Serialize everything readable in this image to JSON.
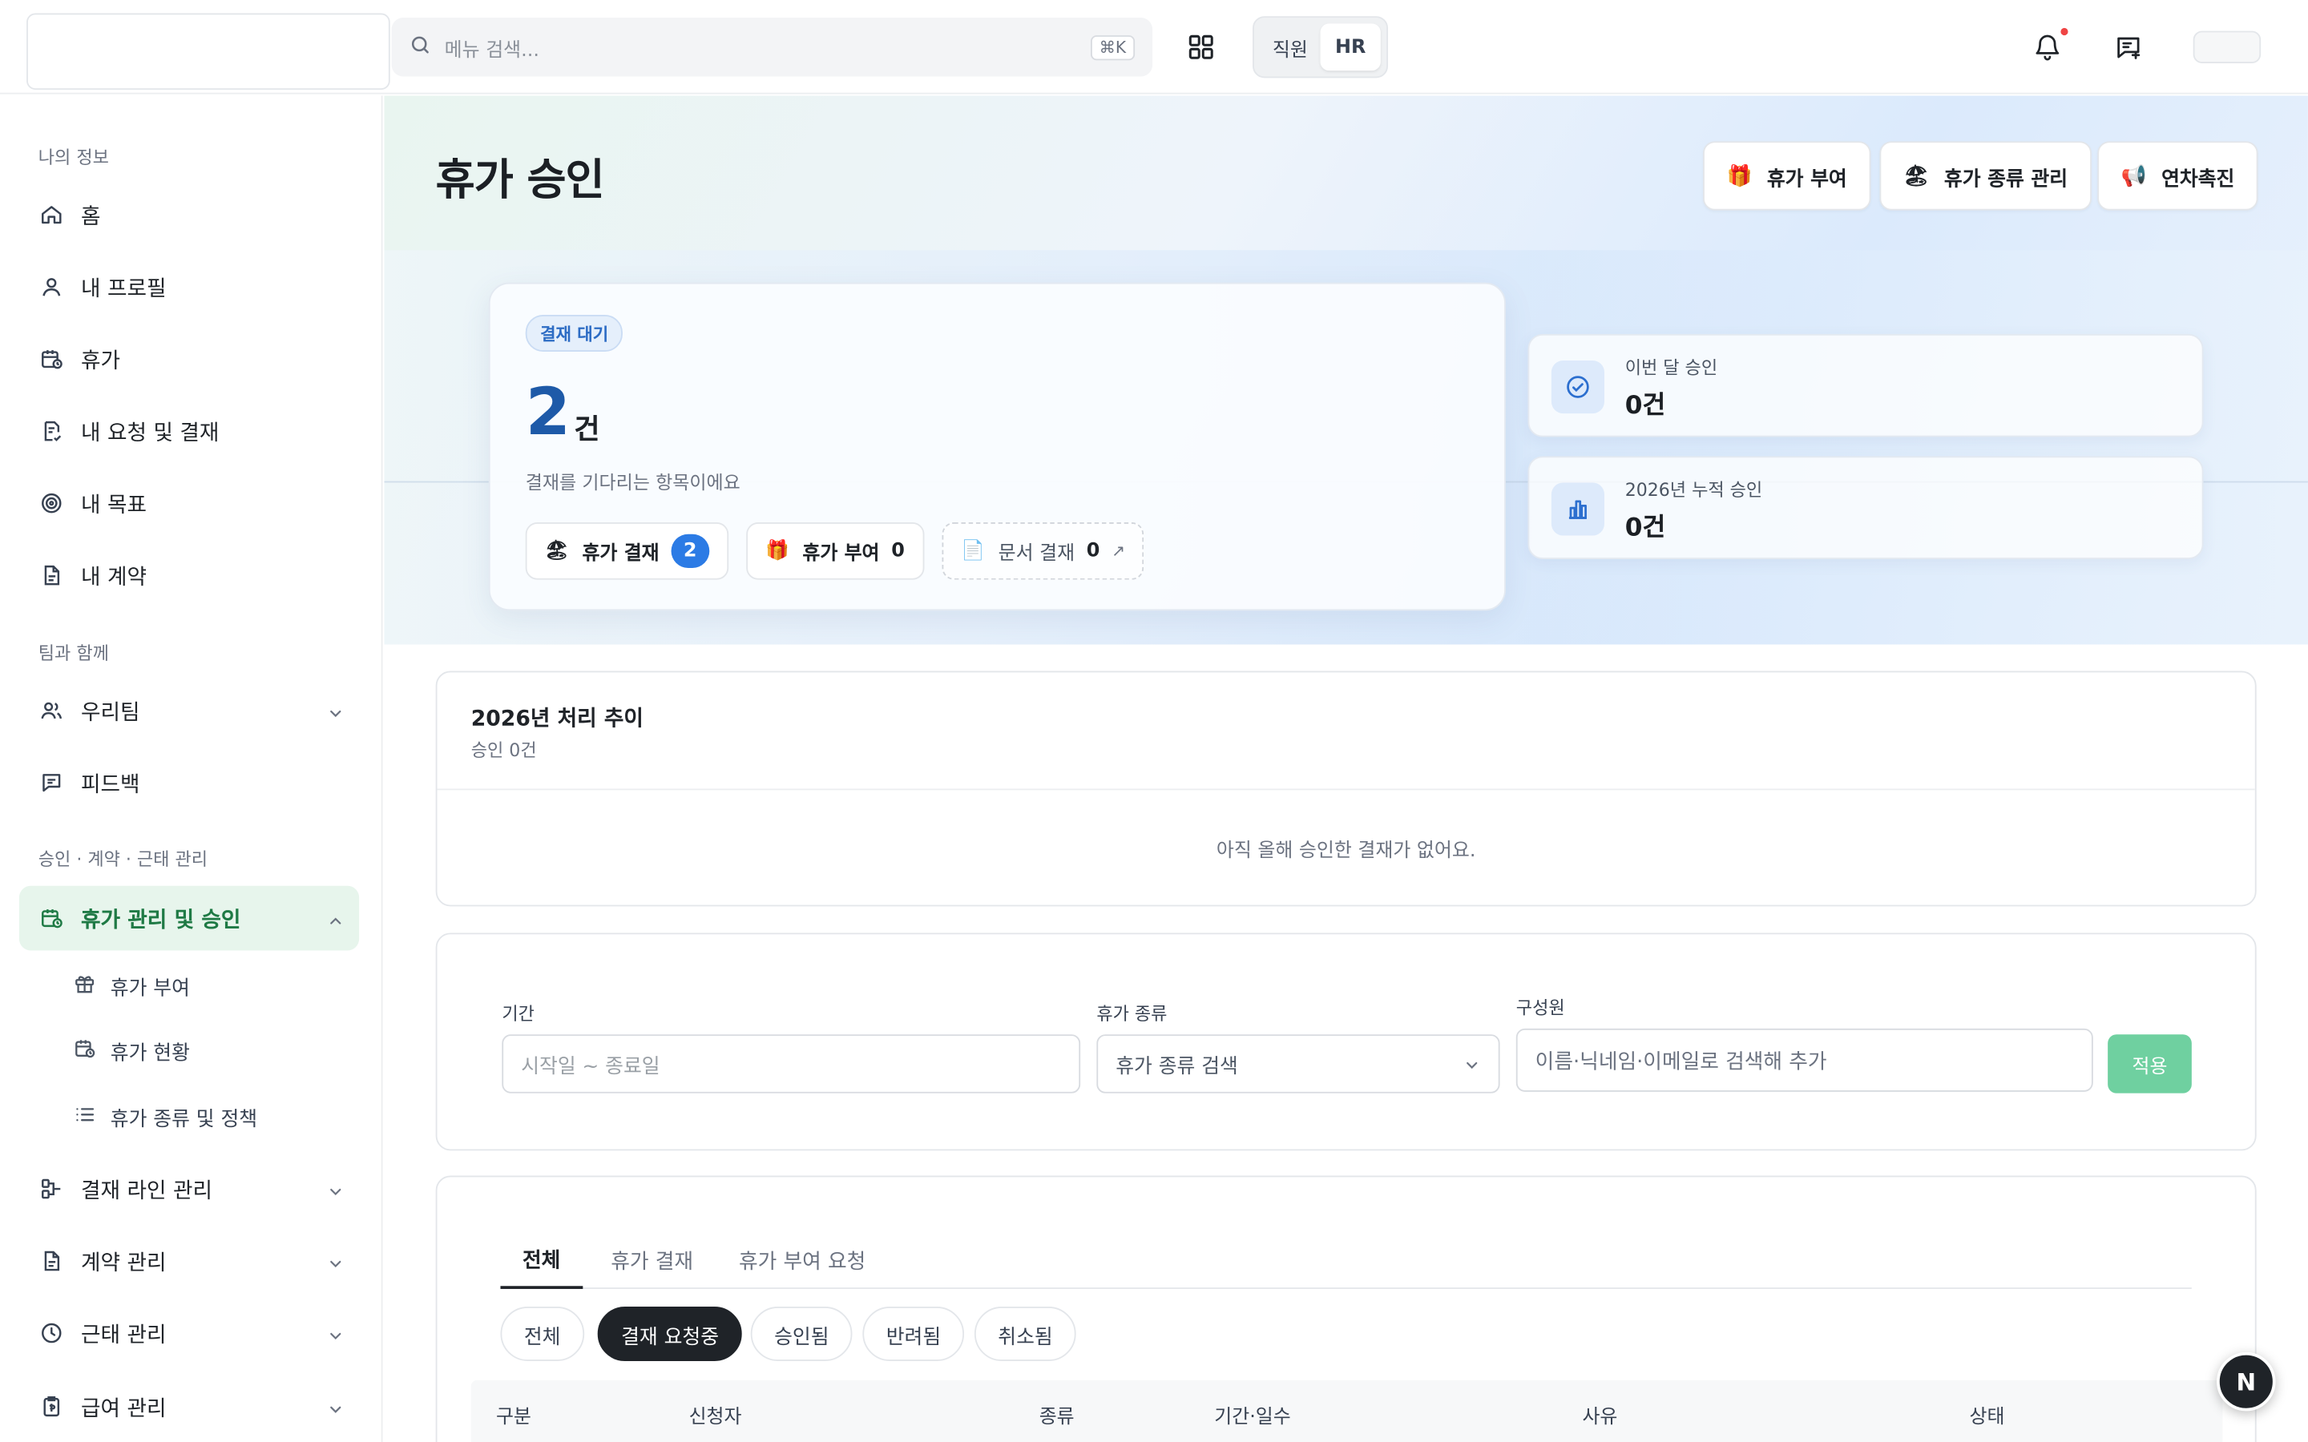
{
  "topbar": {
    "search_placeholder": "메뉴 검색...",
    "search_shortcut": "⌘K",
    "role_options": [
      "직원",
      "HR"
    ],
    "role_selected": "HR"
  },
  "sidebar": {
    "sections": [
      {
        "title": "나의 정보"
      },
      {
        "title": "팀과 함께"
      },
      {
        "title": "승인 · 계약 · 근태 관리"
      }
    ],
    "items": [
      {
        "label": "홈",
        "icon": "home-icon"
      },
      {
        "label": "내 프로필",
        "icon": "user-icon"
      },
      {
        "label": "휴가",
        "icon": "calendar-clock-icon"
      },
      {
        "label": "내 요청 및 결재",
        "icon": "document-check-icon"
      },
      {
        "label": "내 목표",
        "icon": "target-icon"
      },
      {
        "label": "내 계약",
        "icon": "contract-icon"
      },
      {
        "label": "우리팀",
        "icon": "team-icon"
      },
      {
        "label": "피드백",
        "icon": "message-icon"
      },
      {
        "label": "휴가 관리 및 승인",
        "icon": "calendar-clock-icon",
        "active": true
      },
      {
        "label": "결재 라인 관리",
        "icon": "approval-line-icon"
      },
      {
        "label": "계약 관리",
        "icon": "contract-icon"
      },
      {
        "label": "근태 관리",
        "icon": "clock-icon"
      },
      {
        "label": "급여 관리",
        "icon": "payroll-icon"
      }
    ],
    "sub_items": [
      {
        "label": "휴가 부여",
        "icon": "gift-icon"
      },
      {
        "label": "휴가 현황",
        "icon": "calendar-clock-icon"
      },
      {
        "label": "휴가 종류 및 정책",
        "icon": "list-icon"
      }
    ]
  },
  "page": {
    "title": "휴가 승인",
    "actions": [
      {
        "label": "휴가 부여",
        "emoji": "🎁"
      },
      {
        "label": "휴가 종류 관리",
        "emoji": "🏖"
      },
      {
        "label": "연차촉진",
        "emoji": "📢"
      }
    ]
  },
  "pending": {
    "badge": "결재 대기",
    "count": "2",
    "unit": "건",
    "description": "결재를 기다리는 항목이에요",
    "chips": [
      {
        "label": "휴가 결재",
        "value": "2",
        "emoji": "🏖"
      },
      {
        "label": "휴가 부여",
        "value": "0",
        "emoji": "🎁"
      },
      {
        "label": "문서 결재",
        "value": "0",
        "emoji": "📄",
        "arrow": "↗"
      }
    ]
  },
  "stats": [
    {
      "label": "이번 달 승인",
      "value": "0건",
      "icon": "check-circle-icon"
    },
    {
      "label": "2026년 누적 승인",
      "value": "0건",
      "icon": "bar-chart-icon"
    }
  ],
  "trend": {
    "title": "2026년 처리 추이",
    "subtitle": "승인 0건",
    "empty_message": "아직 올해 승인한 결재가 없어요."
  },
  "filters": {
    "period_label": "기간",
    "period_placeholder": "시작일 ~ 종료일",
    "type_label": "휴가 종류",
    "type_value": "휴가 종류 검색",
    "member_label": "구성원",
    "member_placeholder": "이름·닉네임·이메일로 검색해 추가",
    "apply_label": "적용"
  },
  "list": {
    "tabs": [
      "전체",
      "휴가 결재",
      "휴가 부여 요청"
    ],
    "active_tab": "전체",
    "status_filters": [
      "전체",
      "결재 요청중",
      "승인됨",
      "반려됨",
      "취소됨"
    ],
    "active_status": "결재 요청중",
    "columns": [
      "구분",
      "신청자",
      "종류",
      "기간·일수",
      "사유",
      "상태"
    ]
  },
  "fab": {
    "label": "N"
  },
  "colors": {
    "brand_green": "#1f7a45",
    "accent_blue": "#2c7be5",
    "apply_green": "#6fd0a0",
    "notification_red": "#ef4444"
  }
}
